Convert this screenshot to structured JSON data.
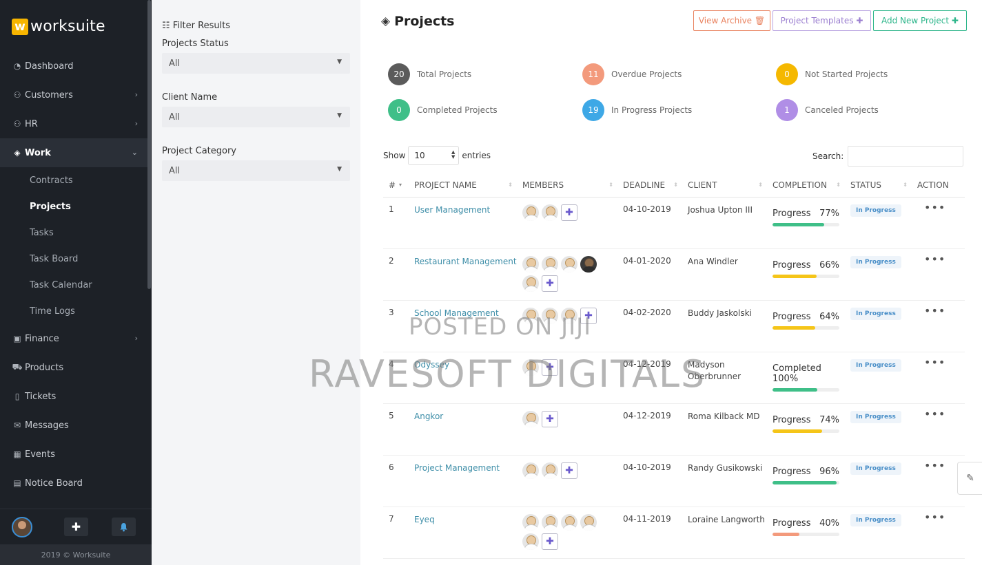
{
  "brand": {
    "logo_letter": "w",
    "name": "worksuite"
  },
  "sidebar": {
    "items": [
      {
        "label": "Dashboard",
        "icon": "dashboard-icon",
        "chevron": false
      },
      {
        "label": "Customers",
        "icon": "customers-icon",
        "chevron": true
      },
      {
        "label": "HR",
        "icon": "user-icon",
        "chevron": true
      },
      {
        "label": "Work",
        "icon": "layers-icon",
        "chevron": true,
        "active": true
      }
    ],
    "sub_items": [
      {
        "label": "Contracts"
      },
      {
        "label": "Projects",
        "active": true
      },
      {
        "label": "Tasks"
      },
      {
        "label": "Task Board"
      },
      {
        "label": "Task Calendar"
      },
      {
        "label": "Time Logs"
      }
    ],
    "items_after": [
      {
        "label": "Finance",
        "icon": "money-icon",
        "chevron": true
      },
      {
        "label": "Products",
        "icon": "cart-icon",
        "chevron": false
      },
      {
        "label": "Tickets",
        "icon": "ticket-icon",
        "chevron": false
      },
      {
        "label": "Messages",
        "icon": "envelope-icon",
        "chevron": false
      },
      {
        "label": "Events",
        "icon": "calendar-icon",
        "chevron": false
      },
      {
        "label": "Notice Board",
        "icon": "notice-icon",
        "chevron": false
      }
    ],
    "copyright": "2019 © Worksuite"
  },
  "filter": {
    "title": "Filter Results",
    "status_label": "Projects Status",
    "status_value": "All",
    "client_label": "Client Name",
    "client_value": "All",
    "category_label": "Project Category",
    "category_value": "All"
  },
  "header": {
    "title": "Projects",
    "view_archive": "View Archive",
    "project_templates": "Project Templates",
    "add_new": "Add New Project"
  },
  "stats": [
    {
      "value": "20",
      "label": "Total Projects",
      "color": "#5b5b5b"
    },
    {
      "value": "11",
      "label": "Overdue Projects",
      "color": "#f39a7c"
    },
    {
      "value": "0",
      "label": "Not Started Projects",
      "color": "#f5b800"
    },
    {
      "value": "0",
      "label": "Completed Projects",
      "color": "#3fbf88"
    },
    {
      "value": "19",
      "label": "In Progress Projects",
      "color": "#3ea8e6"
    },
    {
      "value": "1",
      "label": "Canceled Projects",
      "color": "#b08ee6"
    }
  ],
  "table_controls": {
    "show": "Show",
    "entries_value": "10",
    "entries": "entries",
    "search": "Search:"
  },
  "table": {
    "headers": [
      "#",
      "PROJECT NAME",
      "MEMBERS",
      "DEADLINE",
      "CLIENT",
      "COMPLETION",
      "STATUS",
      "ACTION"
    ],
    "rows": [
      {
        "num": "1",
        "name": "User Management",
        "members": 2,
        "dark": [],
        "deadline": "04-10-2019",
        "client": "Joshua Upton III",
        "completion_label": "Progress",
        "percent": "77%",
        "pct": 77,
        "bar_color": "#3fbf88",
        "status": "In Progress"
      },
      {
        "num": "2",
        "name": "Restaurant Management",
        "members": 5,
        "dark": [
          3
        ],
        "deadline": "04-01-2020",
        "client": "Ana Windler",
        "completion_label": "Progress",
        "percent": "66%",
        "pct": 66,
        "bar_color": "#f5c518",
        "status": "In Progress"
      },
      {
        "num": "3",
        "name": "School Management",
        "members": 3,
        "dark": [],
        "deadline": "04-02-2020",
        "client": "Buddy Jaskolski",
        "completion_label": "Progress",
        "percent": "64%",
        "pct": 64,
        "bar_color": "#f5c518",
        "status": "In Progress"
      },
      {
        "num": "4",
        "name": "Odyssey",
        "members": 1,
        "dark": [],
        "deadline": "04-12-2019",
        "client": "Madyson Oberbrunner",
        "completion_label": "Completed",
        "percent": "100%",
        "pct": 67,
        "bar_color": "#3fbf88",
        "status": "In Progress"
      },
      {
        "num": "5",
        "name": "Angkor",
        "members": 1,
        "dark": [],
        "deadline": "04-12-2019",
        "client": "Roma Kilback MD",
        "completion_label": "Progress",
        "percent": "74%",
        "pct": 74,
        "bar_color": "#f5c518",
        "status": "In Progress"
      },
      {
        "num": "6",
        "name": "Project Management",
        "members": 2,
        "dark": [],
        "deadline": "04-10-2019",
        "client": "Randy Gusikowski",
        "completion_label": "Progress",
        "percent": "96%",
        "pct": 96,
        "bar_color": "#3fbf88",
        "status": "In Progress"
      },
      {
        "num": "7",
        "name": "Eyeq",
        "members": 5,
        "dark": [],
        "deadline": "04-11-2019",
        "client": "Loraine Langworth",
        "completion_label": "Progress",
        "percent": "40%",
        "pct": 40,
        "bar_color": "#f39a7c",
        "status": "In Progress"
      }
    ]
  },
  "watermark": {
    "line1": "POSTED ON JIJI",
    "line2": "RAVESOFT DIGITALS"
  }
}
